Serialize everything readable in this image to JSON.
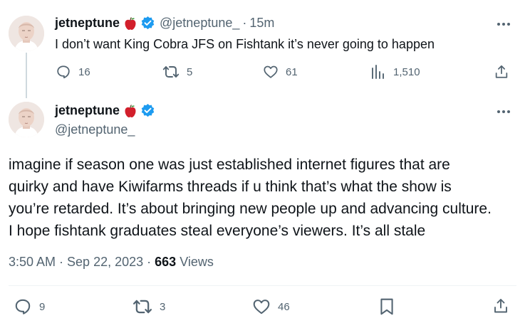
{
  "reply": {
    "display_name": "jetneptune",
    "handle": "@jetneptune_",
    "separator": "·",
    "time": "15m",
    "text": "I don’t want King Cobra JFS on Fishtank it’s never going to happen",
    "stats": {
      "replies": "16",
      "reposts": "5",
      "likes": "61",
      "views": "1,510"
    }
  },
  "main": {
    "display_name": "jetneptune",
    "handle": "@jetneptune_",
    "lines": [
      "imagine if season one was just established internet figures that are",
      "quirky and have Kiwifarms threads if u think that’s what the show is",
      "you’re retarded. It’s about bringing new people up and advancing culture.",
      "I hope fishtank graduates steal everyone’s viewers. It’s all stale"
    ],
    "timestamp": "3:50 AM · Sep 22, 2023 · ",
    "views_count": "663",
    "views_label": " Views",
    "stats": {
      "replies": "9",
      "reposts": "3",
      "likes": "46"
    }
  },
  "colors": {
    "verified": "#1d9bf0",
    "apple": "#d21f2b",
    "secondary_text": "#536471",
    "primary_text": "#0f1419"
  },
  "icons": [
    "apple-emoji-icon",
    "verified-badge-icon",
    "more-icon",
    "reply-icon",
    "repost-icon",
    "like-icon",
    "views-icon",
    "share-icon",
    "bookmark-icon"
  ]
}
